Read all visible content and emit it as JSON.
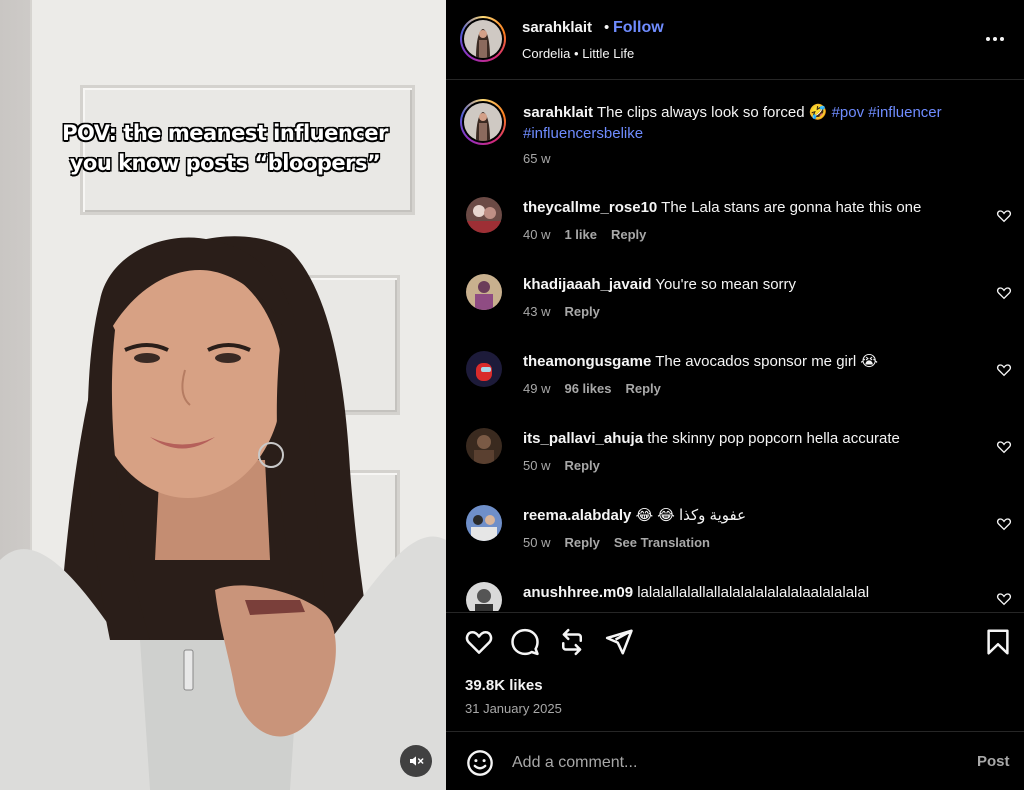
{
  "media": {
    "overlay_line1": "POV: the meanest influencer",
    "overlay_line2": "you know posts “bloopers”",
    "mute_icon": "speaker-muted-icon"
  },
  "header": {
    "username": "sarahklait",
    "separator": "•",
    "follow_label": "Follow",
    "subtitle": "Cordelia • Little Life",
    "more_icon": "more-options-icon"
  },
  "caption": {
    "username": "sarahklait",
    "text": "The clips always look so forced 🤣",
    "tags": [
      "#pov",
      "#influencer",
      "#influencersbelike"
    ],
    "time": "65 w"
  },
  "comments": [
    {
      "username": "theycallme_rose10",
      "text": "The Lala stans are gonna hate this one",
      "time": "40 w",
      "likes": "1 like",
      "reply": "Reply",
      "extra": ""
    },
    {
      "username": "khadijaaah_javaid",
      "text": "You're so mean sorry",
      "time": "43 w",
      "likes": "",
      "reply": "Reply",
      "extra": ""
    },
    {
      "username": "theamongusgame",
      "text": "The avocados sponsor me girl 😭",
      "time": "49 w",
      "likes": "96 likes",
      "reply": "Reply",
      "extra": ""
    },
    {
      "username": "its_pallavi_ahuja",
      "text": "the skinny pop popcorn hella accurate",
      "time": "50 w",
      "likes": "",
      "reply": "Reply",
      "extra": ""
    },
    {
      "username": "reema.alabdaly",
      "text": "😂 😂 عفوية وكذا",
      "time": "50 w",
      "likes": "",
      "reply": "Reply",
      "extra": "See Translation"
    },
    {
      "username": "anushhree.m09",
      "text": "lalalallalallallalalalalalalalaalalalalal",
      "time": "",
      "likes": "",
      "reply": "",
      "extra": ""
    }
  ],
  "actions": {
    "icons": [
      "heart-icon",
      "comment-icon",
      "repost-icon",
      "share-icon",
      "bookmark-icon"
    ],
    "likes_count": "39.8K likes",
    "date": "31 January 2025"
  },
  "add_comment": {
    "placeholder": "Add a comment...",
    "post_label": "Post"
  },
  "colors": {
    "background": "#000000",
    "link_blue": "#6f8cff",
    "secondary_text": "#a8a8a8",
    "divider": "#262626"
  }
}
